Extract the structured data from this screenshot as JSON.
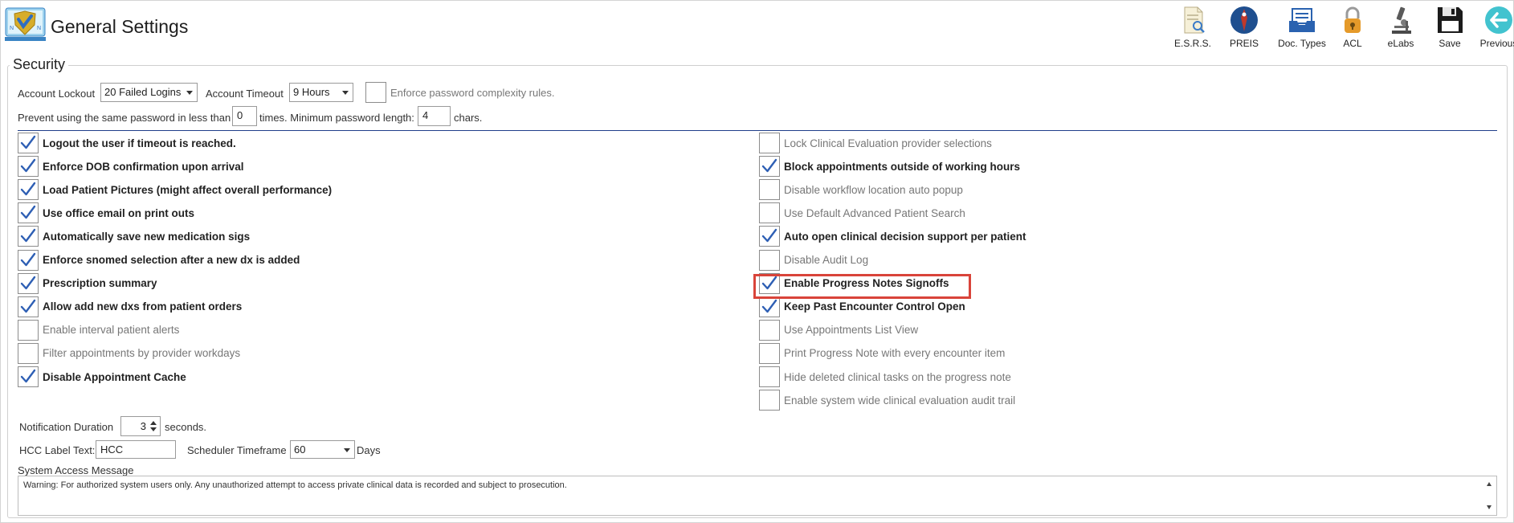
{
  "header": {
    "title": "General Settings"
  },
  "toolbar": {
    "esrs": "E.S.R.S.",
    "preis": "PREIS",
    "doc_types": "Doc. Types",
    "acl": "ACL",
    "elabs": "eLabs",
    "save": "Save",
    "previous": "Previous"
  },
  "security": {
    "legend": "Security",
    "account_lockout_label": "Account Lockout",
    "account_lockout_value": "20 Failed Logins",
    "account_timeout_label": "Account Timeout",
    "account_timeout_value": "9 Hours",
    "enforce_complexity_label": "Enforce password complexity rules.",
    "enforce_complexity_checked": false,
    "prevent_reuse_label": "Prevent using the same password in less than",
    "prevent_reuse_value": "0",
    "times_label": "times. Minimum password length:",
    "min_length_value": "4",
    "chars_label": "chars."
  },
  "left_options": [
    {
      "label": "Logout the user if timeout is reached.",
      "checked": true
    },
    {
      "label": "Enforce DOB confirmation upon arrival",
      "checked": true
    },
    {
      "label": "Load Patient Pictures (might affect overall performance)",
      "checked": true
    },
    {
      "label": "Use office email on print outs",
      "checked": true
    },
    {
      "label": "Automatically save new medication sigs",
      "checked": true
    },
    {
      "label": "Enforce snomed selection after a new dx is added",
      "checked": true
    },
    {
      "label": "Prescription summary",
      "checked": true
    },
    {
      "label": "Allow add new dxs from patient orders",
      "checked": true
    },
    {
      "label": "Enable interval patient alerts",
      "checked": false
    },
    {
      "label": "Filter appointments by provider workdays",
      "checked": false
    },
    {
      "label": "Disable Appointment Cache",
      "checked": true
    }
  ],
  "right_options": [
    {
      "label": "Lock Clinical Evaluation provider selections",
      "checked": false
    },
    {
      "label": "Block appointments outside of working hours",
      "checked": true
    },
    {
      "label": "Disable workflow location auto popup",
      "checked": false
    },
    {
      "label": "Use Default Advanced Patient Search",
      "checked": false
    },
    {
      "label": "Auto open clinical decision support per patient",
      "checked": true
    },
    {
      "label": "Disable Audit Log",
      "checked": false
    },
    {
      "label": "Enable Progress Notes Signoffs",
      "checked": true
    },
    {
      "label": "Keep Past Encounter Control Open",
      "checked": true
    },
    {
      "label": "Use Appointments List View",
      "checked": false
    },
    {
      "label": "Print Progress Note with every encounter item",
      "checked": false
    },
    {
      "label": "Hide deleted clinical tasks on the progress note",
      "checked": false
    },
    {
      "label": "Enable system wide clinical evaluation audit trail",
      "checked": false
    }
  ],
  "bottom": {
    "notification_label": "Notification Duration",
    "notification_value": "3",
    "seconds_label": "seconds.",
    "hcc_label": "HCC Label Text:",
    "hcc_value": "HCC",
    "scheduler_label": "Scheduler Timeframe",
    "scheduler_value": "60",
    "days_label": "Days",
    "system_access_label": "System Access Message",
    "system_access_message": "Warning: For authorized system users only. Any unauthorized attempt to access private clinical data is recorded and subject to prosecution."
  },
  "colors": {
    "check": "#2e5fb4",
    "highlight": "#d9443a",
    "separator": "#1f3f8a"
  }
}
